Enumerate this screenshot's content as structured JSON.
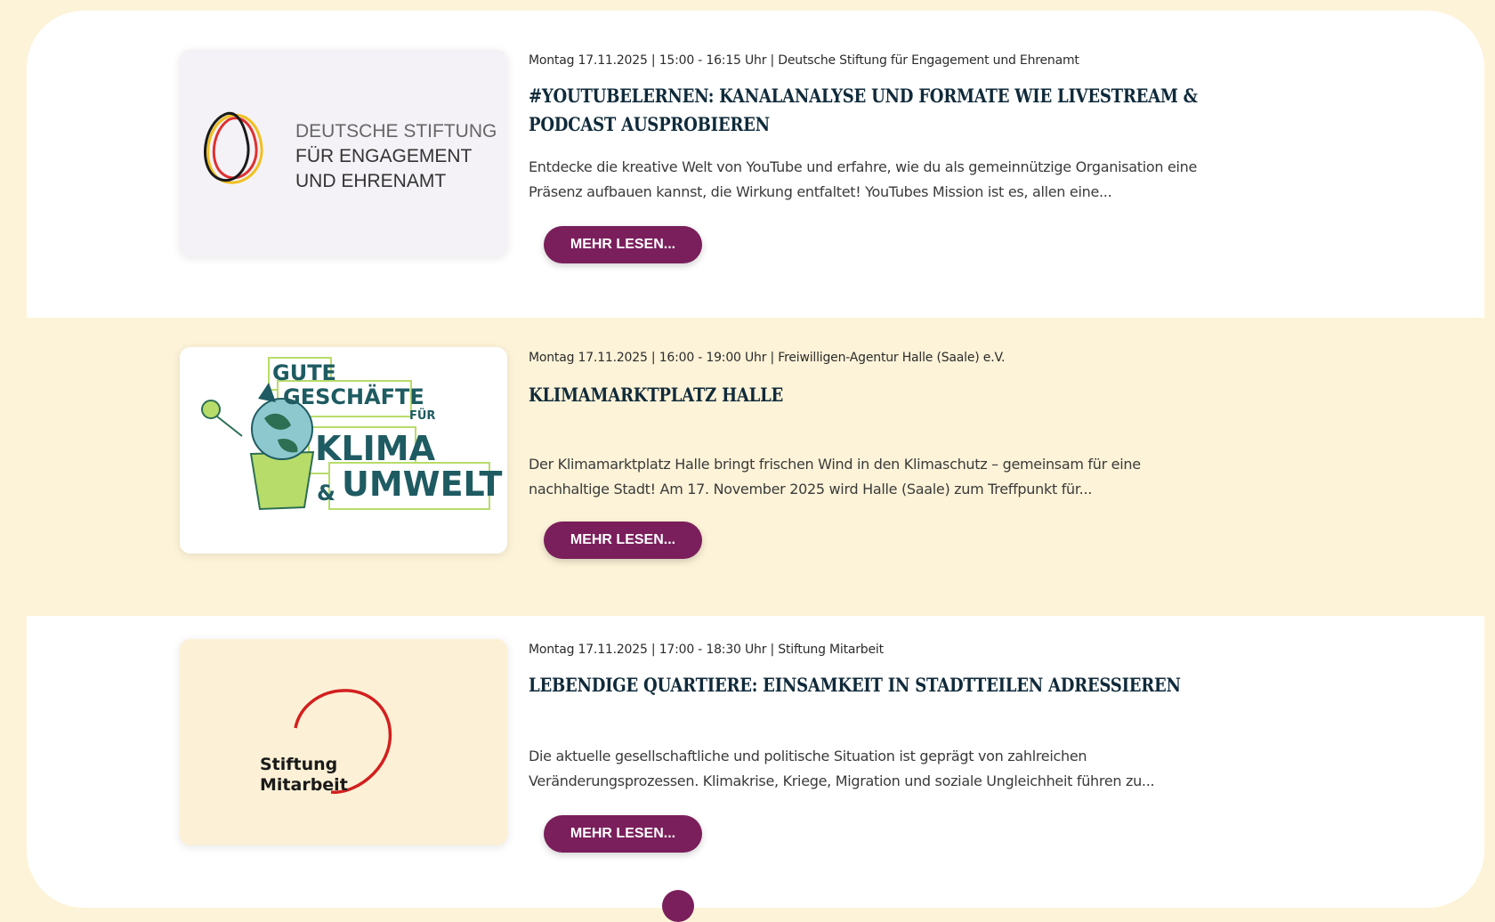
{
  "events": [
    {
      "meta": "Montag 17.11.2025 | 15:00 - 16:15 Uhr | Deutsche Stiftung für Engagement und Ehrenamt",
      "title": "#YouTubeLernen: Kanalanalyse und Formate wie Livestream & Podcast ausprobieren",
      "description": "Entdecke die kreative Welt von YouTube und erfahre, wie du als gemeinnützige Organisation eine Präsenz aufbauen kannst, die Wirkung entfaltet! YouTubes Mission ist es, allen eine...",
      "button": "MEHR LESEN...",
      "logo": {
        "line1": "DEUTSCHE STIFTUNG",
        "line2": "FÜR ENGAGEMENT",
        "line3": "UND EHRENAMT"
      }
    },
    {
      "meta": "Montag 17.11.2025 | 16:00 - 19:00 Uhr | Freiwilligen-Agentur Halle (Saale) e.V.",
      "title": "Klimamarktplatz Halle",
      "description": "Der Klimamarktplatz Halle bringt frischen Wind in den Klimaschutz –  gemeinsam für eine nachhaltige Stadt! Am 17. November 2025 wird Halle (Saale) zum Treffpunkt für...",
      "button": "MEHR LESEN...",
      "logo": {
        "gute": "GUTE",
        "geschaefte": "GESCHÄFTE",
        "fuer": "FÜR",
        "klima": "KLIMA",
        "amp": "&",
        "umwelt": "UMWELT"
      }
    },
    {
      "meta": "Montag 17.11.2025 | 17:00 - 18:30 Uhr | Stiftung Mitarbeit",
      "title": "Lebendige Quartiere: Einsamkeit in Stadtteilen adressieren",
      "description": "Die aktuelle gesellschaftliche und politische Situation ist geprägt von zahlreichen Veränderungsprozessen. Klimakrise, Kriege, Migration und soziale Ungleichheit führen zu...",
      "button": "MEHR LESEN...",
      "logo": {
        "line1": "Stiftung",
        "line2": "Mitarbeit"
      }
    }
  ],
  "colors": {
    "accent": "#7a1f5c",
    "cream": "#fdf3d8",
    "title": "#0f2a3a"
  }
}
